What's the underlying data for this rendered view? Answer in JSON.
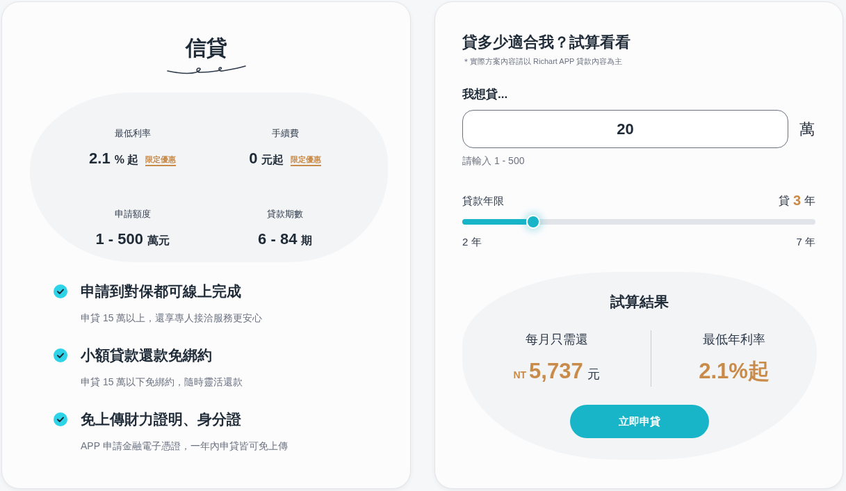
{
  "product_card": {
    "title": "信貸",
    "stats": [
      {
        "label": "最低利率",
        "value": "2.1",
        "unit": "% 起",
        "tag": "限定優惠"
      },
      {
        "label": "手續費",
        "value": "0",
        "unit": "元起",
        "tag": "限定優惠"
      },
      {
        "label": "申請額度",
        "value": "1 - 500",
        "unit": "萬元"
      },
      {
        "label": "貸款期數",
        "value": "6 - 84",
        "unit": "期"
      }
    ],
    "features": [
      {
        "title": "申請到對保都可線上完成",
        "description": "申貸 15 萬以上，還享專人接洽服務更安心"
      },
      {
        "title": "小額貸款還款免綁約",
        "description": "申貸 15 萬以下免綁約，隨時靈活還款"
      },
      {
        "title": "免上傳財力證明、身分證",
        "description": "APP 申請金融電子憑證，一年內申貸皆可免上傳"
      }
    ]
  },
  "calculator": {
    "title": "貸多少適合我？試算看看",
    "note": "＊實際方案內容請以 Richart APP 貸款內容為主",
    "amount": {
      "label": "我想貸...",
      "value": "20",
      "unit": "萬",
      "hint": "請輸入 1 - 500"
    },
    "term": {
      "label": "貸款年限",
      "reading_prefix": "貸",
      "reading_value": "3",
      "reading_unit": "年",
      "level": 0.2,
      "min_label": "2 年",
      "max_label": "7 年"
    },
    "result": {
      "title": "試算結果",
      "monthly": {
        "label": "每月只需還",
        "currency": "NT",
        "amount": "5,737",
        "unit": "元"
      },
      "rate": {
        "label": "最低年利率",
        "value": "2.1%起"
      },
      "button": "立即申貸"
    }
  }
}
